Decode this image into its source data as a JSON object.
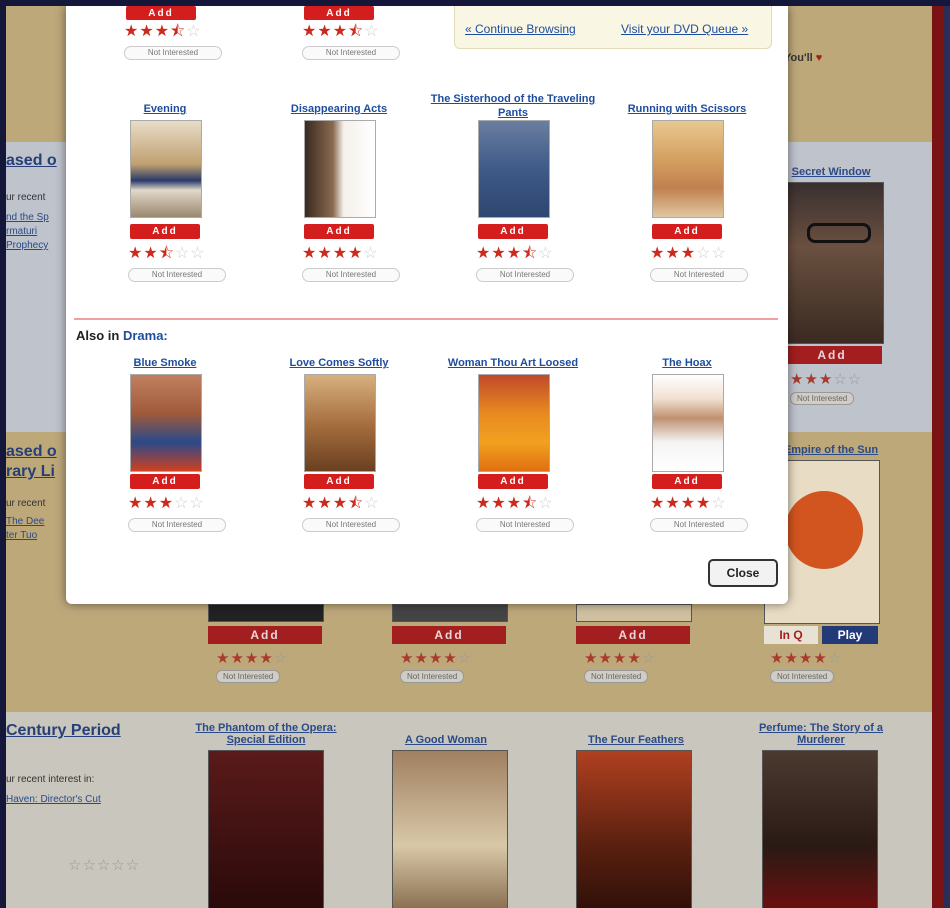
{
  "modal": {
    "continue_browsing": "« Continue Browsing",
    "visit_queue": "Visit your DVD Queue »",
    "also_label": "Also in",
    "also_genre": "Drama:",
    "close_label": "Close",
    "top_partial": [
      {
        "add": "Add",
        "not_interested": "Not Interested",
        "rating": 3.5
      },
      {
        "add": "Add",
        "not_interested": "Not Interested",
        "rating": 3.5
      }
    ],
    "row1": [
      {
        "title": "Evening",
        "add": "Add",
        "not_interested": "Not Interested",
        "rating": 2.5
      },
      {
        "title": "Disappearing Acts",
        "add": "Add",
        "not_interested": "Not Interested",
        "rating": 4
      },
      {
        "title": "The Sisterhood of the Traveling Pants",
        "add": "Add",
        "not_interested": "Not Interested",
        "rating": 3.5
      },
      {
        "title": "Running with Scissors",
        "add": "Add",
        "not_interested": "Not Interested",
        "rating": 3
      }
    ],
    "row2": [
      {
        "title": "Blue Smoke",
        "add": "Add",
        "not_interested": "Not Interested",
        "rating": 3
      },
      {
        "title": "Love Comes Softly",
        "add": "Add",
        "not_interested": "Not Interested",
        "rating": 3.5
      },
      {
        "title": "Woman Thou Art Loosed",
        "add": "Add",
        "not_interested": "Not Interested",
        "rating": 3.5
      },
      {
        "title": "The Hoax",
        "add": "Add",
        "not_interested": "Not Interested",
        "rating": 4
      }
    ]
  },
  "background": {
    "youll_label": "You'll",
    "section1_heading": "ased o",
    "section1_recent": "ur recent",
    "section1_link1": "nd the Sp",
    "section1_link2": "rmaturi",
    "section1_link3": "Prophecy",
    "section2_heading_line1": "ased o",
    "section2_heading_line2": "rary Li",
    "section2_recent": "ur recent",
    "section2_link1": "The Dee",
    "section2_link2": "ter Tuo",
    "secret_window": "Secret Window",
    "empire_sun": "Empire of the Sun",
    "in_q": "In Q",
    "play": "Play",
    "add": "Add",
    "not_interested": "Not Interested",
    "century_heading": "Century Period",
    "century_recent": "ur recent interest in:",
    "century_link": "Haven: Director's Cut",
    "bottom_titles": [
      "The Phantom of the Opera: Special Edition",
      "A Good Woman",
      "The Four Feathers",
      "Perfume: The Story of a Murderer"
    ],
    "row_ratings": [
      4,
      4,
      4,
      4
    ]
  }
}
